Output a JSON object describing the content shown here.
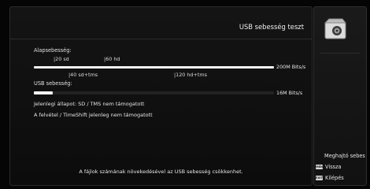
{
  "screen": {
    "title": "USB sebesség teszt",
    "base_speed": {
      "label": "Alapsebesség:",
      "markers_top": [
        "|20 sd",
        "|60 hd"
      ],
      "markers_bottom": [
        "|40 sd+tms",
        "|120 hd+tms"
      ],
      "value_text": "200M Bits/s",
      "fill_fraction": 1.0
    },
    "usb_speed": {
      "label": "USB sebesség:",
      "value_text": "16M Bits/s",
      "fill_fraction": 0.08
    },
    "status_current": "Jelenlegi állapot: SD / TMS nem támogatott",
    "status_record": "A felvétel / TimeShift jelenleg nem támogatott",
    "footer_note": "A fájlok számának növekedésével az USB sebesség csökkenhet."
  },
  "side": {
    "icon": "usb-drive-icon",
    "legend": [
      {
        "key_label": "",
        "key_color": "#d8d8d8",
        "text": "Meghajtó sebes"
      },
      {
        "key_label": "MENU",
        "key_color": "#d8d8d8",
        "text": "Vissza"
      },
      {
        "key_label": "EXIT",
        "key_color": "#d8d8d8",
        "text": "Kilépés"
      }
    ]
  }
}
